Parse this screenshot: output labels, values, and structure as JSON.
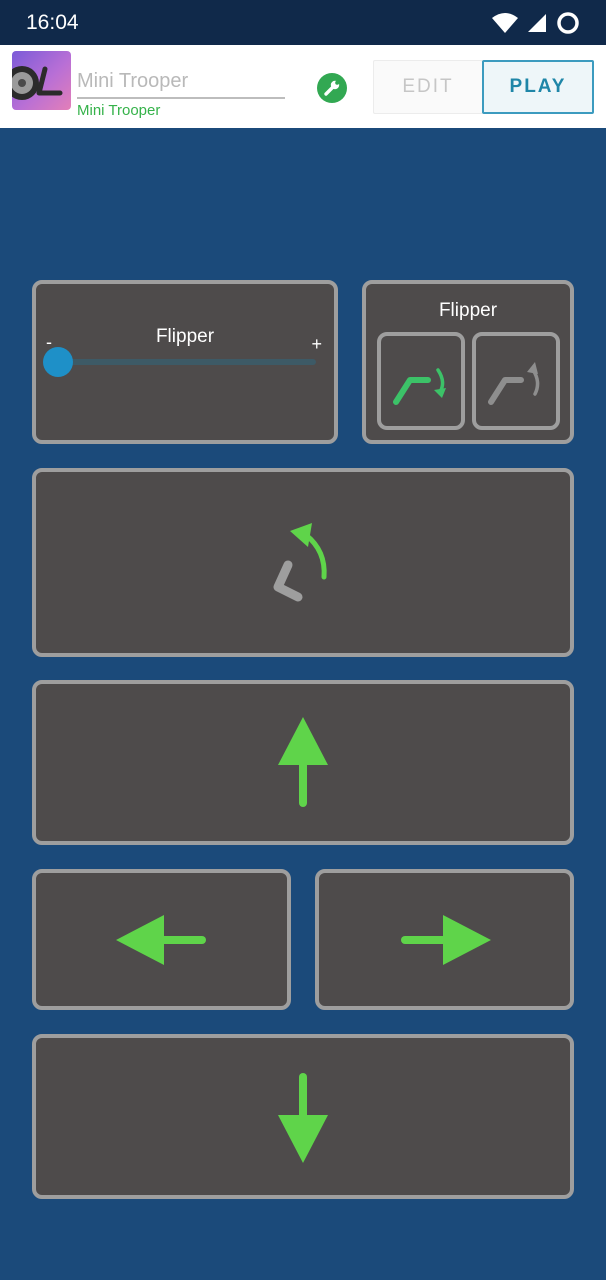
{
  "status_bar": {
    "time": "16:04"
  },
  "header": {
    "robot_name_placeholder": "Mini Trooper",
    "robot_subtitle": "Mini Trooper",
    "edit_label": "EDIT",
    "play_label": "PLAY"
  },
  "flipper_slider": {
    "label": "Flipper",
    "min_label": "-",
    "max_label": "+",
    "value_fraction": 0.0
  },
  "flipper_buttons": {
    "label": "Flipper"
  },
  "colors": {
    "background": "#1b4a7a",
    "panel": "#4e4b4b",
    "panel_border": "#9e9e9e",
    "accent_green": "#5fd44a",
    "slider_thumb": "#1e90c8",
    "play_accent": "#1f86a8"
  },
  "icons": {
    "flip_down": "flipper-down-icon",
    "flip_up": "flipper-up-icon",
    "self_right": "self-right-icon",
    "forward": "arrow-up-icon",
    "left": "arrow-left-icon",
    "right": "arrow-right-icon",
    "reverse": "arrow-down-icon"
  }
}
